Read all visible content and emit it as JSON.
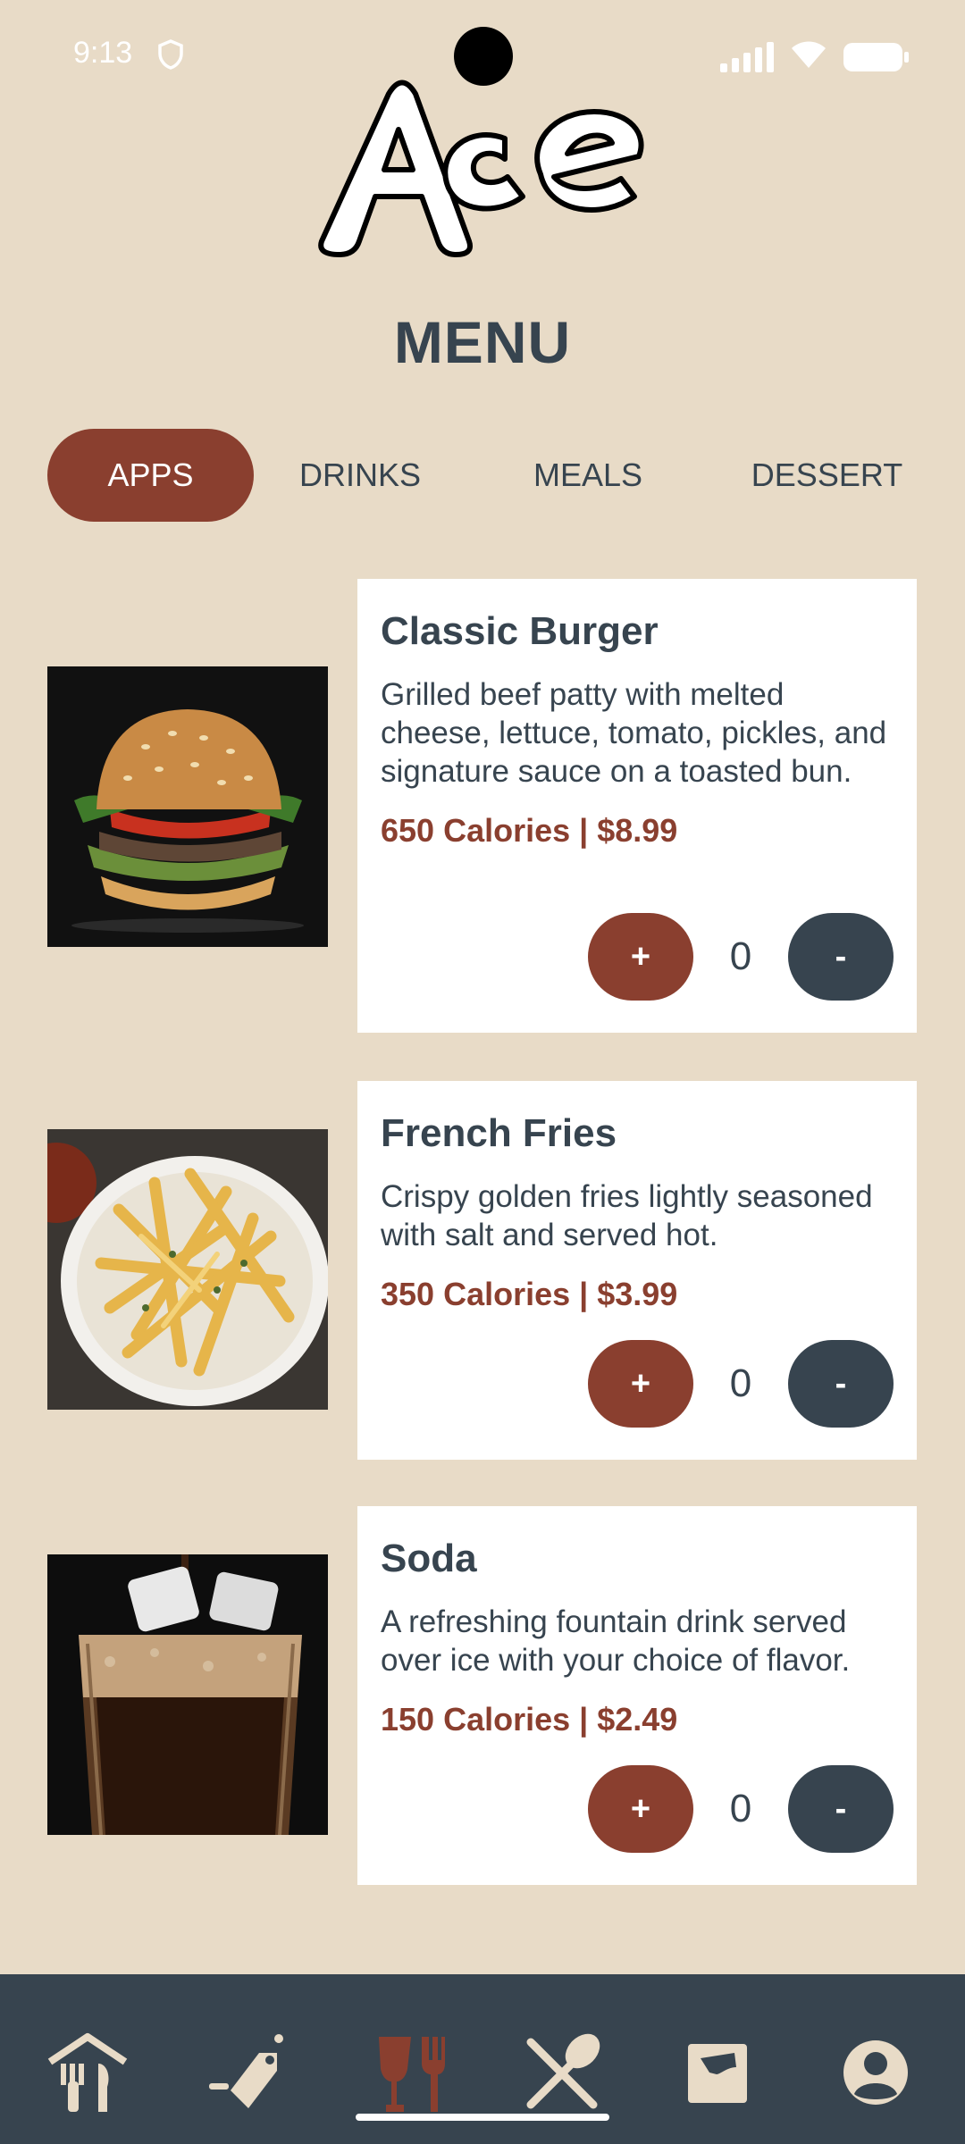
{
  "status_bar": {
    "time": "9:13"
  },
  "page_title": "MENU",
  "tabs": [
    {
      "label": "APPS",
      "active": true
    },
    {
      "label": "DRINKS",
      "active": false
    },
    {
      "label": "MEALS",
      "active": false
    },
    {
      "label": "DESSERT",
      "active": false
    }
  ],
  "items": [
    {
      "name": "Classic Burger",
      "description": "Grilled beef patty with melted cheese, lettuce, tomato, pickles, and signature sauce on a toasted bun.",
      "meta": "650 Calories | $8.99",
      "plus": "+",
      "quantity": "0",
      "minus": "-"
    },
    {
      "name": "French Fries",
      "description": "Crispy golden fries lightly seasoned with salt and served hot.",
      "meta": "350 Calories | $3.99",
      "plus": "+",
      "quantity": "0",
      "minus": "-"
    },
    {
      "name": "Soda",
      "description": "A refreshing fountain drink served over ice with your choice of flavor.",
      "meta": "150 Calories | $2.49",
      "plus": "+",
      "quantity": "0",
      "minus": "-"
    }
  ],
  "nav": [
    {
      "icon": "restaurant-home-icon",
      "active": false
    },
    {
      "icon": "promo-tag-icon",
      "active": false
    },
    {
      "icon": "drinks-menu-icon",
      "active": true
    },
    {
      "icon": "utensils-icon",
      "active": false
    },
    {
      "icon": "wallet-icon",
      "active": false
    },
    {
      "icon": "account-icon",
      "active": false
    }
  ],
  "colors": {
    "background": "#e8dbc7",
    "accent": "#8a3f2f",
    "dark": "#37444f",
    "card": "#ffffff"
  }
}
